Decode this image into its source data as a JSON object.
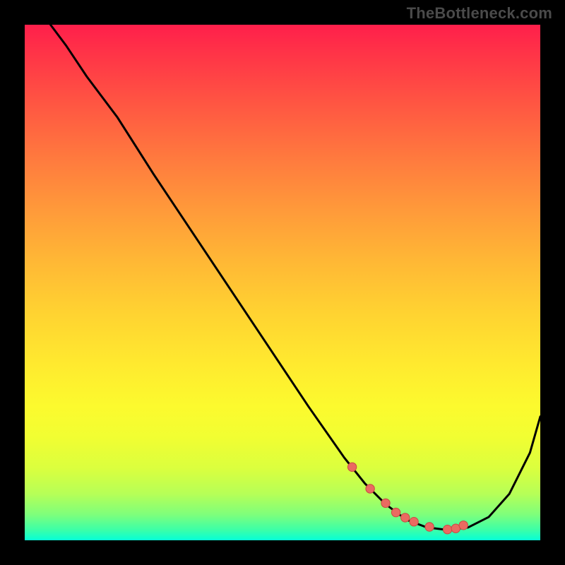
{
  "watermark": "TheBottleneck.com",
  "colors": {
    "background": "#000000",
    "curve": "#000000",
    "marker_fill": "#EA6A61",
    "marker_stroke": "#C94B42",
    "gradient_stops": [
      "#FF1F4B",
      "#FF3547",
      "#FF5842",
      "#FF7A3E",
      "#FF9A3A",
      "#FFB835",
      "#FFD331",
      "#FFEA2F",
      "#FCFA2E",
      "#F1FE32",
      "#DBFF3E",
      "#B6FF57",
      "#7EFF7B",
      "#3BFFA8",
      "#06FFD7"
    ]
  },
  "chart_data": {
    "type": "line",
    "x_range": [
      0,
      100
    ],
    "y_range": [
      0,
      100
    ],
    "note": "Axis units are percentage of plot area; 0,0 at bottom-left. Background encodes y value as a vertical heat gradient (red=high, green=low).",
    "series": [
      {
        "name": "bottleneck-curve",
        "x": [
          5,
          8,
          12,
          18,
          25,
          35,
          45,
          55,
          62,
          66,
          70,
          74,
          78,
          82,
          86,
          90,
          94,
          98,
          100
        ],
        "y": [
          100,
          96,
          90,
          82,
          71,
          56,
          41,
          26,
          16,
          11,
          7,
          4,
          2.5,
          2,
          2.5,
          4.5,
          9,
          17,
          24
        ]
      }
    ],
    "markers": {
      "name": "selected-points",
      "x": [
        63.5,
        67,
        70,
        72,
        73.8,
        75.5,
        78.5,
        82,
        83.6,
        85.1
      ],
      "y": [
        14.2,
        10.0,
        7.2,
        5.4,
        4.4,
        3.6,
        2.6,
        2.1,
        2.3,
        2.9
      ]
    }
  }
}
